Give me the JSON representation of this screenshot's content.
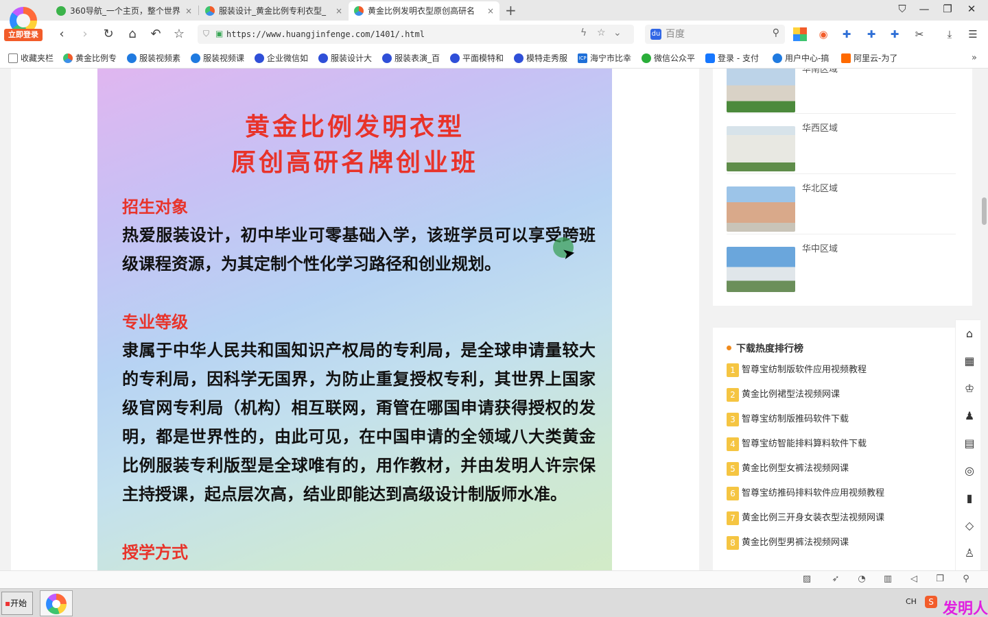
{
  "browser": {
    "login_label": "立即登录",
    "tabs": [
      {
        "title": "360导航_一个主页，整个世界",
        "close": "×"
      },
      {
        "title": "服装设计_黄金比例专利衣型_",
        "close": "×"
      },
      {
        "title": "黄金比例发明衣型原创高研名",
        "close": "×"
      }
    ],
    "new_tab": "+",
    "window_controls": [
      "⛉",
      "—",
      "❐",
      "✕"
    ],
    "url": "https://www.huangjinfenge.com/1401/.html",
    "search_placeholder": "百度"
  },
  "bookmarks": [
    "收藏夹栏",
    "黄金比例专",
    "服装视频素",
    "服装视频课",
    "企业微信如",
    "服装设计大",
    "服装表演_百",
    "平面模特和",
    "模特走秀服",
    "海宁市比幸",
    "微信公众平",
    "登录 - 支付",
    "用户中心-搞",
    "阿里云-为了"
  ],
  "bookmarks_more": "»",
  "poster": {
    "title_line1": "黄金比例发明衣型",
    "title_line2": "原创高研名牌创业班",
    "section1_title": "招生对象",
    "section1_text": "热爱服装设计，初中毕业可零基础入学，该班学员可以享受跨班级课程资源，为其定制个性化学习路径和创业规划。",
    "section2_title": "专业等级",
    "section2_text": "隶属于中华人民共和国知识产权局的专利局，是全球申请量较大的专利局，因科学无国界，为防止重复授权专利，其世界上国家级官网专利局（机构）相互联网，甭管在哪国申请获得授权的发明，都是世界性的，由此可见，在中国申请的全领域八大类黄金比例服装专利版型是全球唯有的，用作教材，并由发明人许宗保主持授课，起点层次高，结业即能达到高级设计制版师水准。",
    "section3_title": "授学方式"
  },
  "regions": [
    "华南区域",
    "华西区域",
    "华北区域",
    "华中区域"
  ],
  "ranking": {
    "title": "下载热度排行榜",
    "items": [
      {
        "num": "1",
        "label": "智尊宝纺制版软件应用视频教程"
      },
      {
        "num": "2",
        "label": "黄金比例裙型法视频网课"
      },
      {
        "num": "3",
        "label": "智尊宝纺制版推码软件下载"
      },
      {
        "num": "4",
        "label": "智尊宝纺智能排料算料软件下载"
      },
      {
        "num": "5",
        "label": "黄金比例型女裤法视频网课"
      },
      {
        "num": "6",
        "label": "智尊宝纺推码排料软件应用视频教程"
      },
      {
        "num": "7",
        "label": "黄金比例三开身女装衣型法视频网课"
      },
      {
        "num": "8",
        "label": "黄金比例型男裤法视频网课"
      }
    ]
  },
  "taskbar": {
    "start_label": "开始",
    "lang": "CH",
    "ime": "S"
  },
  "watermark": "发明人",
  "colors": {
    "accent_red": "#e8332a",
    "login_orange": "#f25c2a",
    "rank_badge": "#f5c542"
  }
}
